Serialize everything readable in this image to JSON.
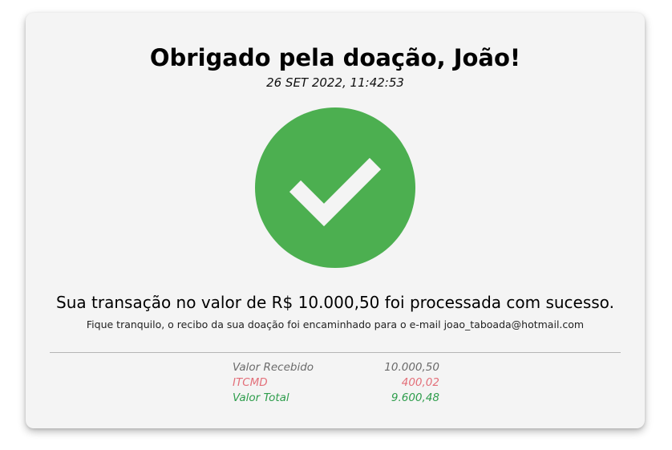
{
  "header": {
    "title": "Obrigado pela doação, João!",
    "datetime": "26 SET 2022, 11:42:53"
  },
  "status": {
    "icon": "check-circle-icon",
    "circle_color": "#4caf50",
    "check_color": "#f4f4f4"
  },
  "message": {
    "main": "Sua transação no valor de R$ 10.000,50 foi processada com sucesso.",
    "detail": "Fique tranquilo, o recibo da sua doação foi encaminhado para o e-mail joao_taboada@hotmail.com"
  },
  "summary": {
    "rows": [
      {
        "label": "Valor Recebido",
        "value": "10.000,50",
        "color": "#6a6a6a"
      },
      {
        "label": "ITCMD",
        "value": "400,02",
        "color": "#e3707a"
      },
      {
        "label": "Valor Total",
        "value": "9.600,48",
        "color": "#2e9d4c"
      }
    ]
  }
}
